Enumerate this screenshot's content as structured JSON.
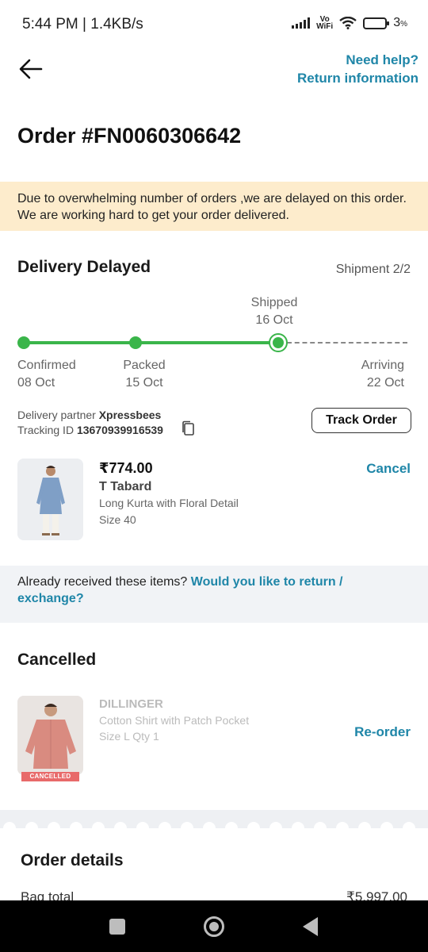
{
  "status_bar": {
    "time_speed": "5:44 PM | 1.4KB/s",
    "volte_top": "Vo",
    "volte_bottom": "WiFi",
    "battery": "3",
    "battery_unit": "%"
  },
  "header": {
    "need_help": "Need help?",
    "return_info": "Return information"
  },
  "order": {
    "title": "Order #FN0060306642",
    "delay_message": "Due to overwhelming number of orders ,we are delayed on this order. We are working hard to get your order delivered."
  },
  "delivery": {
    "status": "Delivery Delayed",
    "shipment": "Shipment 2/2",
    "steps": [
      {
        "label": "Confirmed",
        "date": "08 Oct"
      },
      {
        "label": "Packed",
        "date": "15 Oct"
      },
      {
        "label": "Shipped",
        "date": "16 Oct"
      },
      {
        "label": "Arriving",
        "date": "22 Oct"
      }
    ],
    "partner_label": "Delivery partner",
    "partner_name": "Xpressbees",
    "tracking_label": "Tracking ID",
    "tracking_id": "13670939916539",
    "track_button": "Track Order"
  },
  "item": {
    "price": "₹774.00",
    "brand": "T Tabard",
    "description": "Long Kurta with Floral Detail",
    "size": "Size 40",
    "cancel_label": "Cancel"
  },
  "return_prompt": {
    "text": "Already received these items? ",
    "link": "Would you like to return / exchange?"
  },
  "cancelled": {
    "title": "Cancelled",
    "brand": "DILLINGER",
    "description": "Cotton Shirt with Patch Pocket",
    "size_qty": "Size L  Qty  1",
    "badge": "CANCELLED",
    "reorder_label": "Re-order"
  },
  "order_details": {
    "title": "Order details",
    "bag_total_label": "Bag total",
    "bag_total_value": "₹5,997.00"
  },
  "colors": {
    "accent": "#1f86a8",
    "progress": "#3ab54a",
    "banner": "#fdeccc",
    "cancel_badge": "#e86a6a"
  },
  "icons": [
    "back-arrow-icon",
    "copy-icon",
    "signal-icon",
    "wifi-icon",
    "battery-icon",
    "nav-recents-icon",
    "nav-home-icon",
    "nav-back-icon"
  ]
}
